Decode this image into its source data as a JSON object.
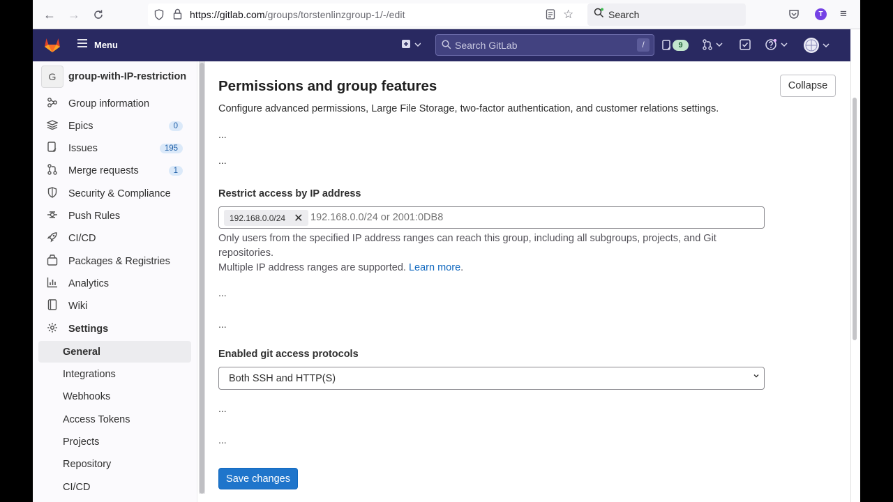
{
  "browser": {
    "url_host": "https://gitlab.com",
    "url_path": "/groups/torstenlinzgroup-1/-/edit",
    "search_label": "Search",
    "profile_initial": "T"
  },
  "topbar": {
    "menu_label": "Menu",
    "search_placeholder": "Search GitLab",
    "search_shortcut": "/",
    "issues_badge": "9"
  },
  "sidebar": {
    "group_initial": "G",
    "group_name": "group-with-IP-restriction",
    "items": [
      {
        "label": "Group information",
        "icon": "group-info-icon"
      },
      {
        "label": "Epics",
        "icon": "epic-icon",
        "count": "0"
      },
      {
        "label": "Issues",
        "icon": "issues-icon",
        "count": "195"
      },
      {
        "label": "Merge requests",
        "icon": "merge-request-icon",
        "count": "1"
      },
      {
        "label": "Security & Compliance",
        "icon": "shield-icon"
      },
      {
        "label": "Push Rules",
        "icon": "push-rules-icon"
      },
      {
        "label": "CI/CD",
        "icon": "rocket-icon"
      },
      {
        "label": "Packages & Registries",
        "icon": "package-icon"
      },
      {
        "label": "Analytics",
        "icon": "chart-icon"
      },
      {
        "label": "Wiki",
        "icon": "book-icon"
      },
      {
        "label": "Settings",
        "icon": "gear-icon"
      }
    ],
    "settings_sub": [
      "General",
      "Integrations",
      "Webhooks",
      "Access Tokens",
      "Projects",
      "Repository",
      "CI/CD"
    ]
  },
  "main": {
    "title": "Permissions and group features",
    "description": "Configure advanced permissions, Large File Storage, two-factor authentication, and customer relations settings.",
    "collapse_label": "Collapse",
    "ellipsis": "...",
    "ip": {
      "label": "Restrict access by IP address",
      "token": "192.168.0.0/24",
      "placeholder": "192.168.0.0/24 or 2001:0DB8",
      "help_line1": "Only users from the specified IP address ranges can reach this group, including all subgroups, projects, and Git repositories.",
      "help_line2": "Multiple IP address ranges are supported.",
      "learn_more": "Learn more",
      "period": "."
    },
    "git": {
      "label": "Enabled git access protocols",
      "selected": "Both SSH and HTTP(S)"
    },
    "save_label": "Save changes"
  }
}
